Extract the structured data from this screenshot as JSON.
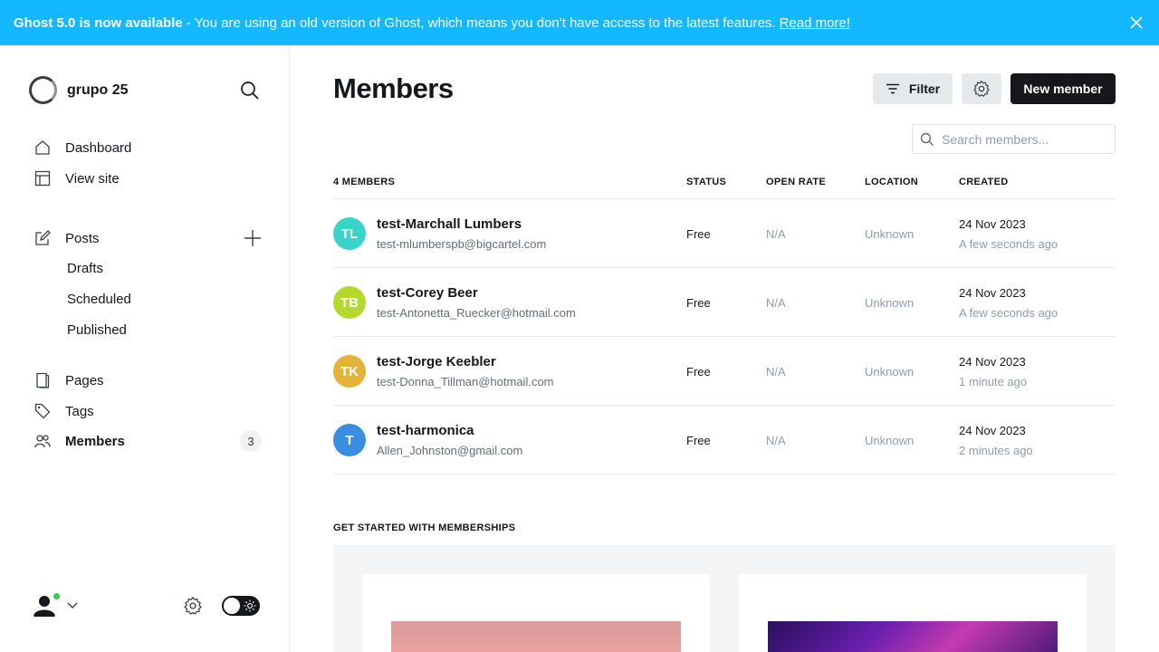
{
  "banner": {
    "bold": "Ghost 5.0 is now available",
    "separator": "-",
    "message": "You are using an old version of Ghost, which means you don't have access to the latest features.",
    "link": "Read more!"
  },
  "sidebar": {
    "site_name": "grupo 25",
    "nav": {
      "dashboard": "Dashboard",
      "view_site": "View site",
      "posts": "Posts",
      "drafts": "Drafts",
      "scheduled": "Scheduled",
      "published": "Published",
      "pages": "Pages",
      "tags": "Tags",
      "members": "Members",
      "members_count": "3"
    }
  },
  "main": {
    "title": "Members",
    "filter_label": "Filter",
    "new_member_label": "New member",
    "search_placeholder": "Search members...",
    "columns": {
      "count": "4 MEMBERS",
      "status": "STATUS",
      "open_rate": "OPEN RATE",
      "location": "LOCATION",
      "created": "CREATED"
    },
    "members": [
      {
        "initials": "TL",
        "color": "#39d3c8",
        "name": "test-Marchall Lumbers",
        "email": "test-mlumberspb@bigcartel.com",
        "status": "Free",
        "open_rate": "N/A",
        "location": "Unknown",
        "date": "24 Nov 2023",
        "ago": "A few seconds ago"
      },
      {
        "initials": "TB",
        "color": "#b4d82b",
        "name": "test-Corey Beer",
        "email": "test-Antonetta_Ruecker@hotmail.com",
        "status": "Free",
        "open_rate": "N/A",
        "location": "Unknown",
        "date": "24 Nov 2023",
        "ago": "A few seconds ago"
      },
      {
        "initials": "TK",
        "color": "#e3b33a",
        "name": "test-Jorge Keebler",
        "email": "test-Donna_Tillman@hotmail.com",
        "status": "Free",
        "open_rate": "N/A",
        "location": "Unknown",
        "date": "24 Nov 2023",
        "ago": "1 minute ago"
      },
      {
        "initials": "T",
        "color": "#3a8ee0",
        "name": "test-harmonica",
        "email": "Allen_Johnston@gmail.com",
        "status": "Free",
        "open_rate": "N/A",
        "location": "Unknown",
        "date": "24 Nov 2023",
        "ago": "2 minutes ago"
      }
    ],
    "get_started_label": "GET STARTED WITH MEMBERSHIPS"
  },
  "icons": {
    "close": "close-icon",
    "search": "search-icon",
    "home": "home-icon",
    "view_site": "layout-icon",
    "posts": "edit-icon",
    "plus": "plus-icon",
    "pages": "page-icon",
    "tags": "tag-icon",
    "members": "members-icon",
    "filter": "filter-icon",
    "gear": "gear-icon",
    "chevron": "chevron-down-icon",
    "sun": "sun-icon"
  },
  "colors": {
    "banner": "#14b8ff",
    "primary": "#15171a",
    "online": "#30cf43"
  }
}
